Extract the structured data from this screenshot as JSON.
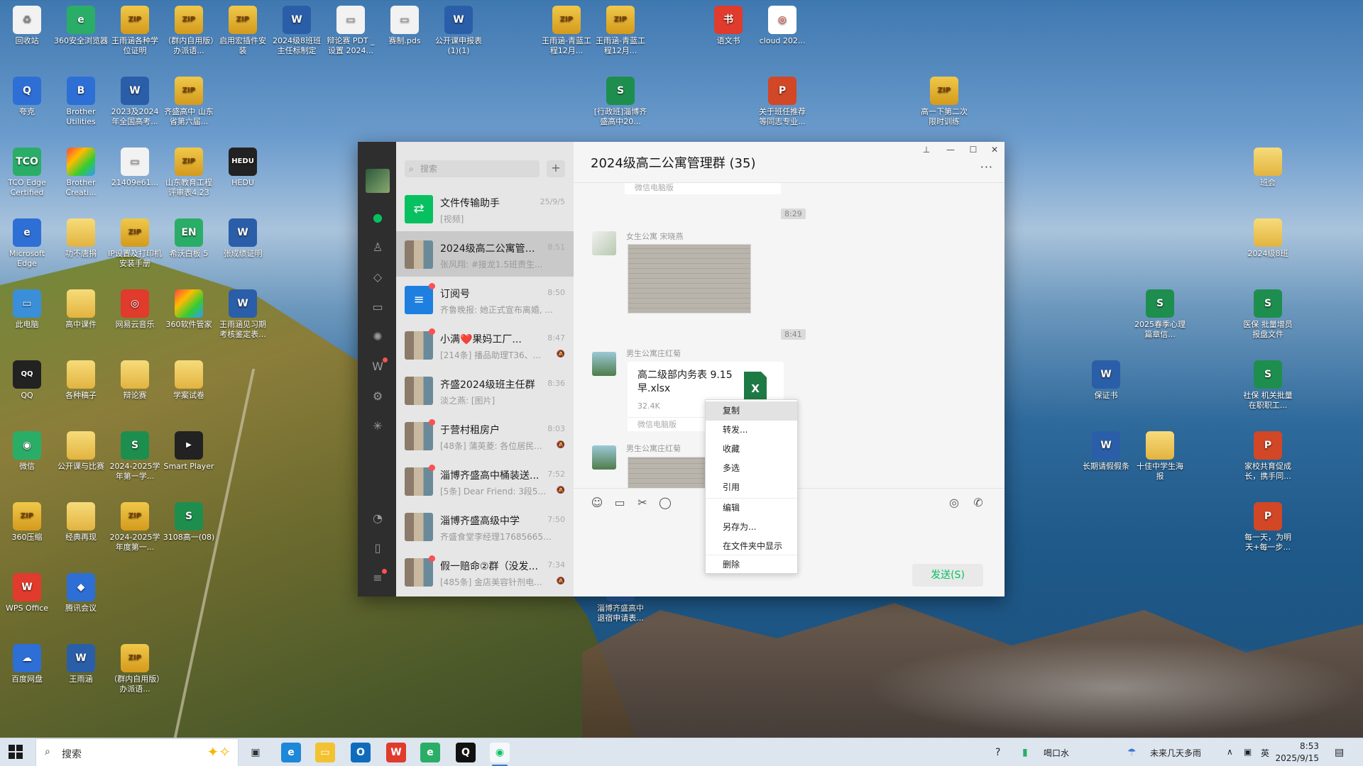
{
  "desktop": {
    "icons": [
      {
        "label": "回收站",
        "kind": "doc",
        "glyph": "♻",
        "icon": "recycle-bin-icon"
      },
      {
        "label": "360安全浏览器",
        "kind": "green",
        "glyph": "e",
        "icon": "browser-icon"
      },
      {
        "label": "王雨涵各种学位证明",
        "kind": "zip",
        "glyph": "ZIP",
        "icon": "archive-icon"
      },
      {
        "label": "（群内自用版）办派语...",
        "kind": "zip",
        "glyph": "ZIP",
        "icon": "archive-icon"
      },
      {
        "label": "启用宏插件安装",
        "kind": "zip",
        "glyph": "ZIP",
        "icon": "archive-icon"
      },
      {
        "label": "2024级8班班主任标制定",
        "kind": "word",
        "glyph": "W",
        "icon": "word-doc-icon"
      },
      {
        "label": "辩论赛 PDT _设置 2024...",
        "kind": "doc",
        "glyph": "▭",
        "icon": "file-icon"
      },
      {
        "label": "赛制.pds",
        "kind": "doc",
        "glyph": "▭",
        "icon": "file-icon"
      },
      {
        "label": "公开课申报表(1)(1)",
        "kind": "word",
        "glyph": "W",
        "icon": "word-doc-icon"
      },
      {
        "label": "王雨涵-青蓝工程12月...",
        "kind": "zip",
        "glyph": "ZIP",
        "icon": "archive-icon"
      },
      {
        "label": "王雨涵-青蓝工程12月...",
        "kind": "zip",
        "glyph": "ZIP",
        "icon": "archive-icon"
      },
      {
        "label": "语文书",
        "kind": "red",
        "glyph": "书",
        "icon": "book-icon"
      },
      {
        "label": "cloud 202...",
        "kind": "white",
        "glyph": "◎",
        "icon": "music-icon"
      },
      {
        "label": "夸克",
        "kind": "app",
        "glyph": "Q",
        "icon": "quark-icon"
      },
      {
        "label": "Brother Utilities",
        "kind": "app",
        "glyph": "B",
        "icon": "printer-icon"
      },
      {
        "label": "2023及2024年全国高考...",
        "kind": "word",
        "glyph": "W",
        "icon": "word-doc-icon"
      },
      {
        "label": "齐盛高中 山东省第六届...",
        "kind": "zip",
        "glyph": "ZIP",
        "icon": "archive-icon"
      },
      {
        "label": "[行政班]淄博齐盛高中20...",
        "kind": "sheet",
        "glyph": "S",
        "icon": "spreadsheet-icon"
      },
      {
        "label": "关于班任推荐等同志专业...",
        "kind": "ppt",
        "glyph": "P",
        "icon": "presentation-icon"
      },
      {
        "label": "高一下第二次限时训练",
        "kind": "zip",
        "glyph": "ZIP",
        "icon": "archive-icon"
      },
      {
        "label": "TCO Edge Certified",
        "kind": "green",
        "glyph": "TCO",
        "icon": "certificate-icon"
      },
      {
        "label": "Brother Creati...",
        "kind": "multi",
        "glyph": "",
        "icon": "app-icon"
      },
      {
        "label": "21409e61...",
        "kind": "doc",
        "glyph": "▭",
        "icon": "file-icon"
      },
      {
        "label": "山东教育工程评审表4.23",
        "kind": "zip",
        "glyph": "ZIP",
        "icon": "archive-icon"
      },
      {
        "label": "HEDU",
        "kind": "dark",
        "glyph": "HEDU",
        "icon": "app-icon"
      },
      {
        "label": "班会",
        "kind": "folder",
        "glyph": "",
        "icon": "folder-icon"
      },
      {
        "label": "Microsoft Edge",
        "kind": "app",
        "glyph": "e",
        "icon": "edge-icon"
      },
      {
        "label": "功不唐捐",
        "kind": "folder",
        "glyph": "",
        "icon": "folder-icon"
      },
      {
        "label": "IP设置及打印机安装手册",
        "kind": "zip",
        "glyph": "ZIP",
        "icon": "archive-icon"
      },
      {
        "label": "希沃白板 5",
        "kind": "green",
        "glyph": "EN",
        "icon": "whiteboard-icon"
      },
      {
        "label": "张成绩证明",
        "kind": "word",
        "glyph": "W",
        "icon": "word-doc-icon"
      },
      {
        "label": "2024级8班",
        "kind": "folder",
        "glyph": "",
        "icon": "folder-icon"
      },
      {
        "label": "此电脑",
        "kind": "pc",
        "glyph": "▭",
        "icon": "computer-icon"
      },
      {
        "label": "高中课件",
        "kind": "folder",
        "glyph": "",
        "icon": "folder-icon"
      },
      {
        "label": "网易云音乐",
        "kind": "red",
        "glyph": "◎",
        "icon": "music-icon"
      },
      {
        "label": "360软件管家",
        "kind": "multi",
        "glyph": "",
        "icon": "app-store-icon"
      },
      {
        "label": "王雨涵见习期考核鉴定表...",
        "kind": "word",
        "glyph": "W",
        "icon": "word-doc-icon"
      },
      {
        "label": "2025春季心理篇章信...",
        "kind": "sheet",
        "glyph": "S",
        "icon": "spreadsheet-icon"
      },
      {
        "label": "医保 批量增员报盘文件",
        "kind": "sheet",
        "glyph": "S",
        "icon": "spreadsheet-icon"
      },
      {
        "label": "QQ",
        "kind": "dark",
        "glyph": "QQ",
        "icon": "qq-icon"
      },
      {
        "label": "各种稿子",
        "kind": "folder",
        "glyph": "",
        "icon": "folder-icon"
      },
      {
        "label": "辩论赛",
        "kind": "folder",
        "glyph": "",
        "icon": "folder-icon"
      },
      {
        "label": "学案试卷",
        "kind": "folder",
        "glyph": "",
        "icon": "folder-icon"
      },
      {
        "label": "保证书",
        "kind": "word",
        "glyph": "W",
        "icon": "word-doc-icon"
      },
      {
        "label": "社保 机关批量在职职工...",
        "kind": "sheet",
        "glyph": "S",
        "icon": "spreadsheet-icon"
      },
      {
        "label": "微信",
        "kind": "green",
        "glyph": "◉",
        "icon": "wechat-icon"
      },
      {
        "label": "公开课与比赛",
        "kind": "folder",
        "glyph": "",
        "icon": "folder-icon"
      },
      {
        "label": "2024-2025学年第一学...",
        "kind": "sheet",
        "glyph": "S",
        "icon": "spreadsheet-icon"
      },
      {
        "label": "Smart Player",
        "kind": "dark",
        "glyph": "▶",
        "icon": "player-icon"
      },
      {
        "label": "长期请假假条",
        "kind": "word",
        "glyph": "W",
        "icon": "word-doc-icon"
      },
      {
        "label": "十佳中学生海报",
        "kind": "folder",
        "glyph": "",
        "icon": "folder-icon"
      },
      {
        "label": "家校共育促成长，携手同...",
        "kind": "ppt",
        "glyph": "P",
        "icon": "presentation-icon"
      },
      {
        "label": "360压缩",
        "kind": "zip",
        "glyph": "ZIP",
        "icon": "archive-icon"
      },
      {
        "label": "经典再现",
        "kind": "folder",
        "glyph": "",
        "icon": "folder-icon"
      },
      {
        "label": "2024-2025学年度第一...",
        "kind": "zip",
        "glyph": "ZIP",
        "icon": "archive-icon"
      },
      {
        "label": "3108高一(08)",
        "kind": "sheet",
        "glyph": "S",
        "icon": "spreadsheet-icon"
      },
      {
        "label": "每一天，为明天+每一步...",
        "kind": "ppt",
        "glyph": "P",
        "icon": "presentation-icon"
      },
      {
        "label": "WPS Office",
        "kind": "red",
        "glyph": "W",
        "icon": "wps-icon"
      },
      {
        "label": "腾讯会议",
        "kind": "app",
        "glyph": "◆",
        "icon": "meeting-icon"
      },
      {
        "label": "淄博齐盛高中退宿申请表...",
        "kind": "word",
        "glyph": "W",
        "icon": "word-doc-icon"
      },
      {
        "label": "百度网盘",
        "kind": "app",
        "glyph": "☁",
        "icon": "cloud-drive-icon"
      },
      {
        "label": "王雨涵",
        "kind": "word",
        "glyph": "W",
        "icon": "word-doc-icon"
      },
      {
        "label": "（群内自用版）办派语...",
        "kind": "zip",
        "glyph": "ZIP",
        "icon": "archive-icon"
      }
    ]
  },
  "wechat": {
    "search_placeholder": "搜索",
    "add_glyph": "+",
    "conversations": [
      {
        "title": "文件传输助手",
        "time": "25/9/5",
        "preview": "[视频]",
        "avatar": "filehelper",
        "glyph": "⇄",
        "unread_dot": false,
        "muted": false,
        "selected": false
      },
      {
        "title": "2024级高二公寓管理群",
        "time": "8:51",
        "preview": "张风翔: #接龙1.5班责生...",
        "avatar": "grid",
        "glyph": "",
        "unread_dot": false,
        "muted": false,
        "selected": true
      },
      {
        "title": "订阅号",
        "time": "8:50",
        "preview": "齐鲁晚报: 她正式宣布离婚, ...",
        "avatar": "subs",
        "glyph": "≡",
        "unread_dot": true,
        "muted": false,
        "selected": false
      },
      {
        "title": "小满❤️果妈工厂...",
        "time": "8:47",
        "preview": "[214条] 播品助理T36、...",
        "avatar": "grid",
        "glyph": "",
        "unread_dot": true,
        "muted": true,
        "selected": false
      },
      {
        "title": "齐盛2024级班主任群",
        "time": "8:36",
        "preview": "淡之燕: [图片]",
        "avatar": "grid",
        "glyph": "",
        "unread_dot": false,
        "muted": false,
        "selected": false
      },
      {
        "title": "于营村租房户",
        "time": "8:03",
        "preview": "[48条] 蒲英菱: 各位居民...",
        "avatar": "grid",
        "glyph": "",
        "unread_dot": true,
        "muted": true,
        "selected": false
      },
      {
        "title": "淄博齐盛高中桶装送...",
        "time": "7:52",
        "preview": "[5条] Dear Friend: 3段5...",
        "avatar": "grid",
        "glyph": "",
        "unread_dot": true,
        "muted": true,
        "selected": false
      },
      {
        "title": "淄博齐盛高级中学",
        "time": "7:50",
        "preview": "齐盛食堂李经理1768566556...",
        "avatar": "grid",
        "glyph": "",
        "unread_dot": false,
        "muted": false,
        "selected": false
      },
      {
        "title": "假一赔命②群（没发...",
        "time": "7:34",
        "preview": "[485条] 金店美容针剂电...",
        "avatar": "grid",
        "glyph": "",
        "unread_dot": true,
        "muted": true,
        "selected": false
      }
    ],
    "chat": {
      "title": "2024级高二公寓管理群 (35)",
      "prev_card_footer": "微信电脑版",
      "time1": "8:29",
      "sender1": "女生公寓 宋晓燕",
      "time2": "8:41",
      "sender2": "男生公寓庄红菊",
      "file_name": "高二级部内务表 9.15早.xlsx",
      "file_size": "32.4K",
      "file_icon_glyph": "X",
      "file_footer": "微信电脑版",
      "sender3": "男生公寓庄红菊",
      "send_label": "发送(S)"
    },
    "context_menu": [
      "复制",
      "转发...",
      "收藏",
      "多选",
      "引用",
      "编辑",
      "另存为...",
      "在文件夹中显示",
      "删除"
    ]
  },
  "taskbar": {
    "search_label": "搜索",
    "water_label": "喝口水",
    "weather_label": "未来几天多雨",
    "ime_label": "英",
    "time": "8:53",
    "date": "2025/9/15"
  },
  "colors": {
    "wechat_green": "#07c160",
    "nav_bg": "#2e2e2e",
    "unread_red": "#fa5151"
  }
}
